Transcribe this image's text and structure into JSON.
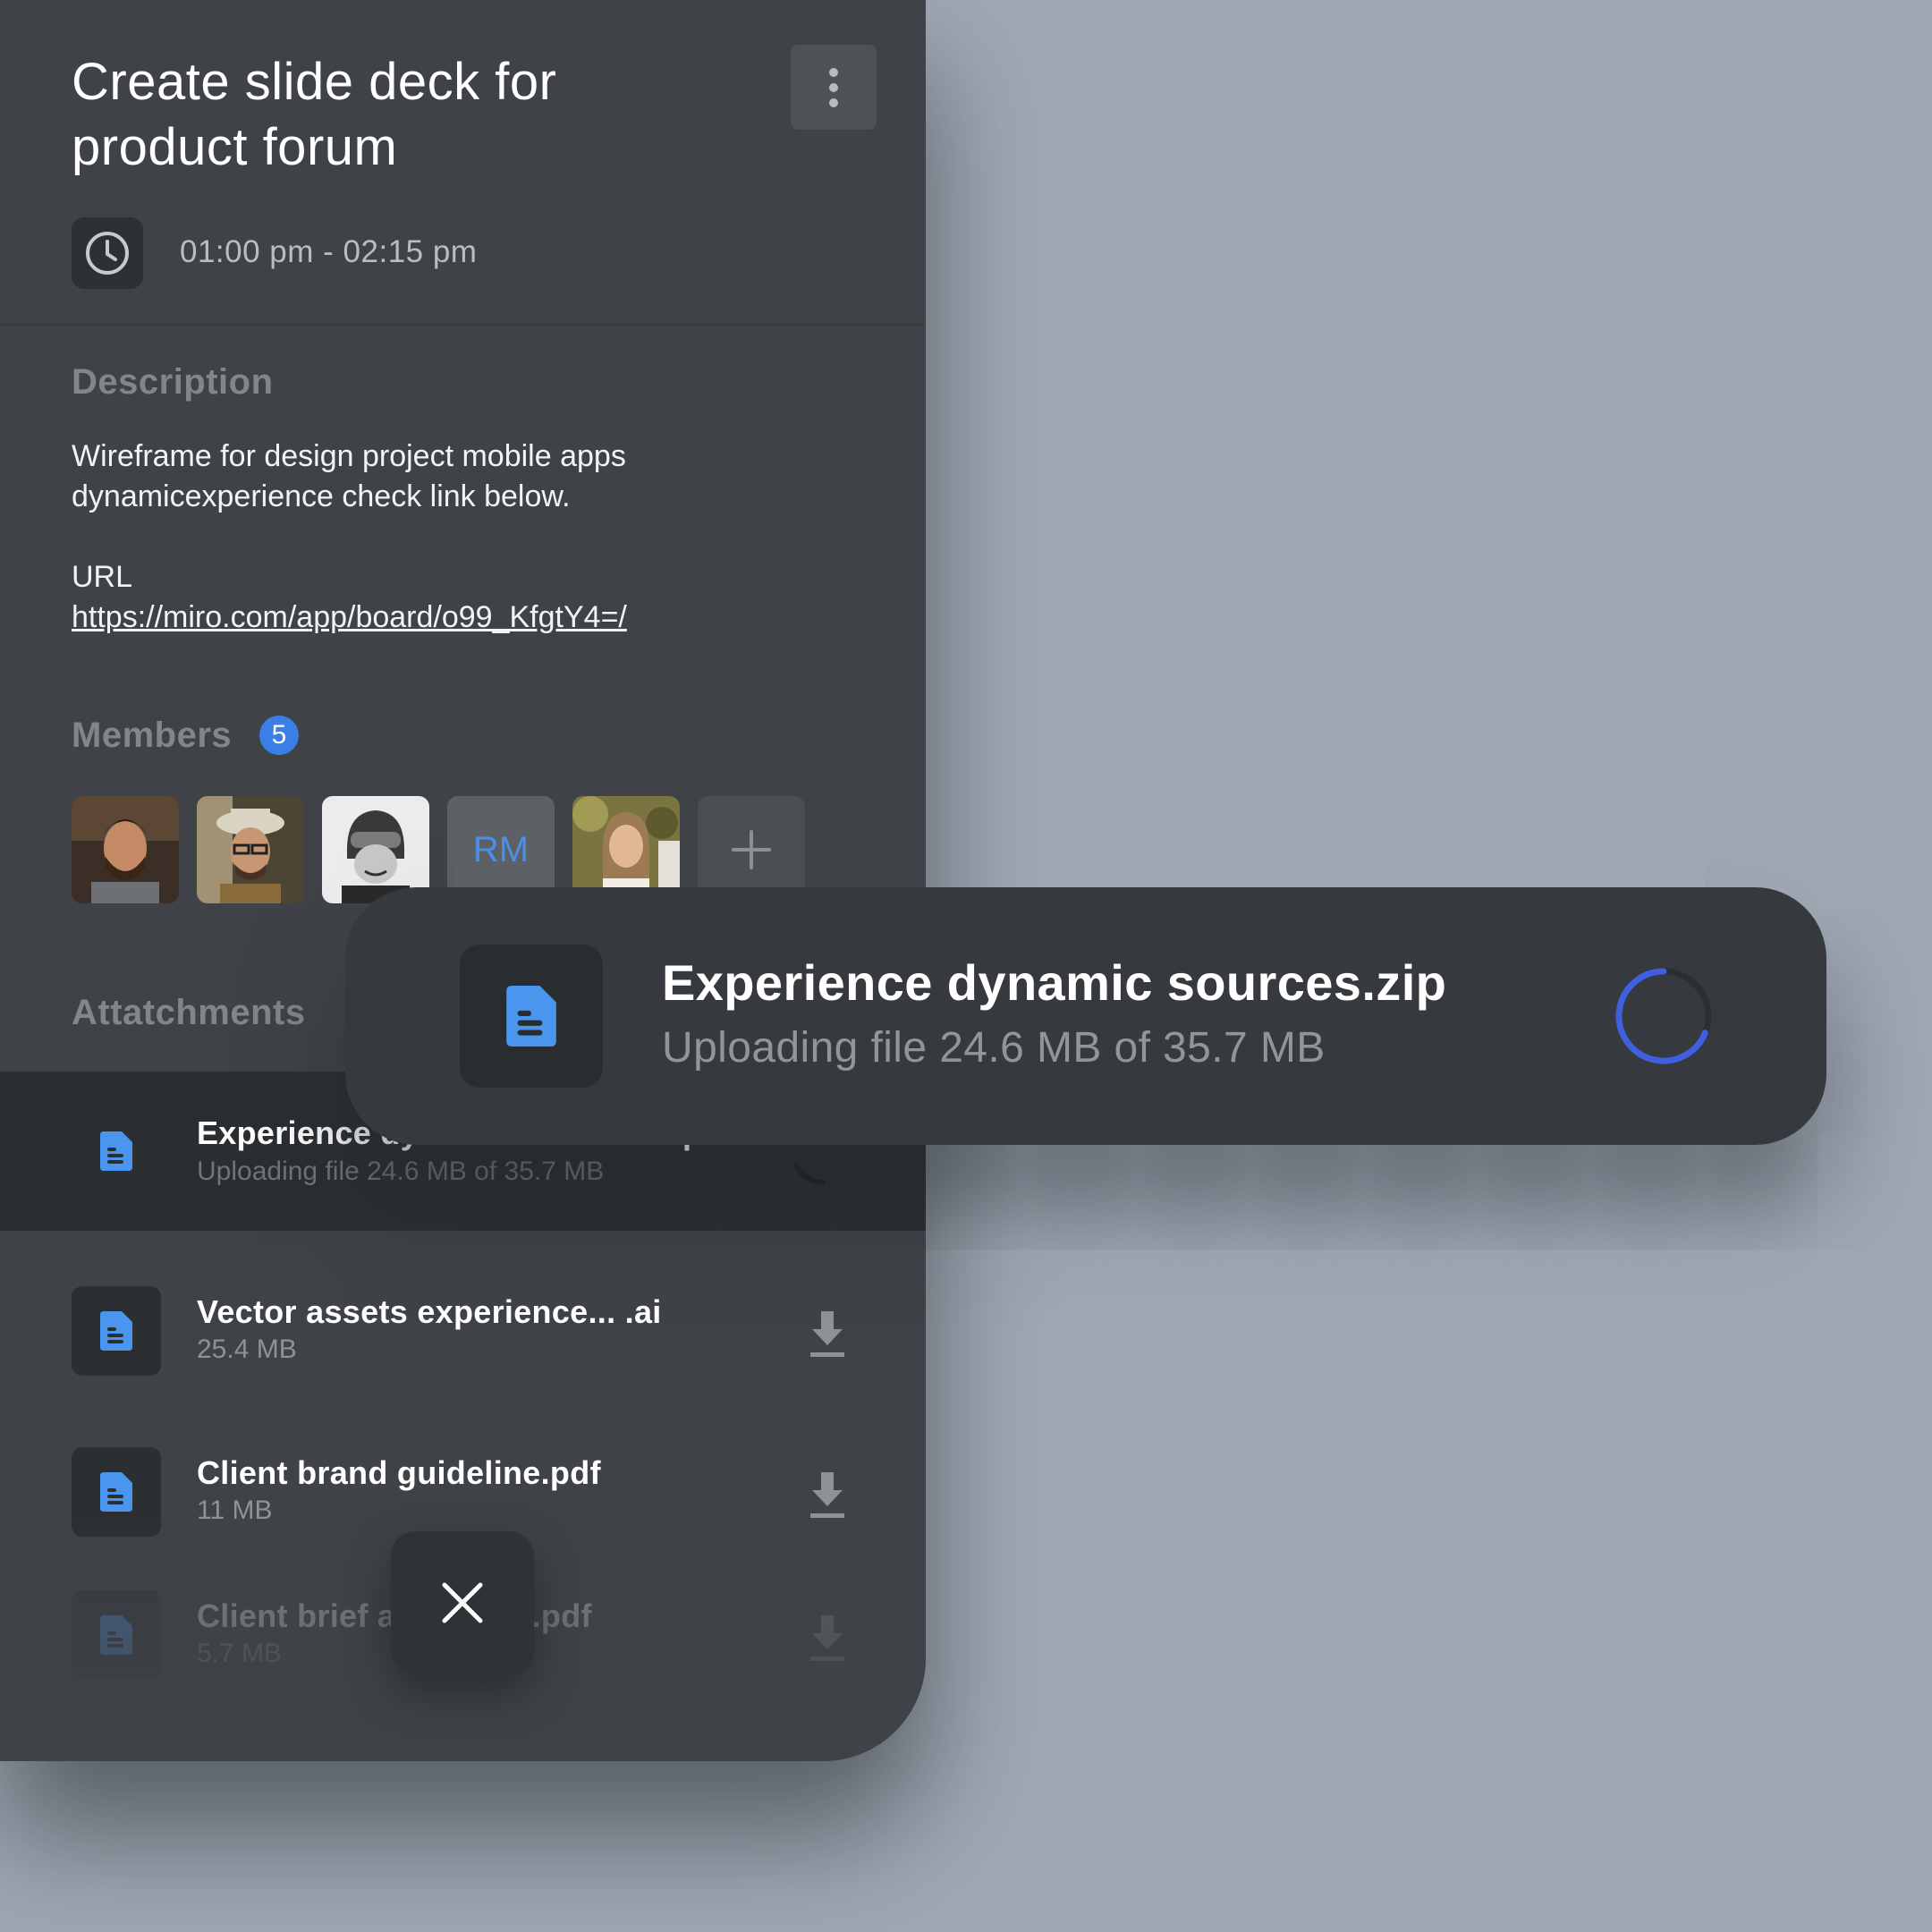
{
  "task": {
    "title": "Create slide deck for product forum",
    "time_range": "01:00 pm - 02:15 pm"
  },
  "description": {
    "label": "Description",
    "text": "Wireframe for design project mobile apps dynamicexperience check link below.",
    "url_label": "URL",
    "url": "https://miro.com/app/board/o99_KfgtY4=/"
  },
  "members": {
    "label": "Members",
    "count": "5",
    "initials_avatar": "RM",
    "avatar_colors": [
      "#5a4634",
      "#8a7a60",
      "#d8d8d8",
      "#5d6166",
      "#8f8a5a"
    ]
  },
  "attachments": {
    "label": "Attatchments",
    "items": [
      {
        "name": "Experience dynamic sources.zip",
        "size": "Uploading file 24.6 MB of 35.7 MB",
        "status": "uploading"
      },
      {
        "name": "Vector assets experience... .ai",
        "size": "25.4 MB",
        "status": "download"
      },
      {
        "name": "Client brand guideline.pdf",
        "size": "11 MB",
        "status": "download"
      },
      {
        "name": "Client brief and notes.pdf",
        "size": "5.7 MB",
        "status": "download"
      }
    ]
  },
  "upload_toast": {
    "file_name": "Experience dynamic sources.zip",
    "status": "Uploading file 24.6 MB of 35.7 MB",
    "uploaded_mb": 24.6,
    "total_mb": 35.7
  },
  "colors": {
    "accent": "#3b7ee8",
    "file_icon": "#4a95ee",
    "spinner": "#3f5fe0",
    "panel": "#3f4347",
    "background": "#9fa8b3"
  },
  "icons": {
    "more": "more-vertical-icon",
    "clock": "clock-icon",
    "file": "file-document-icon",
    "download": "download-icon",
    "add": "plus-icon",
    "close": "close-icon",
    "spinner": "loading-spinner-icon"
  }
}
